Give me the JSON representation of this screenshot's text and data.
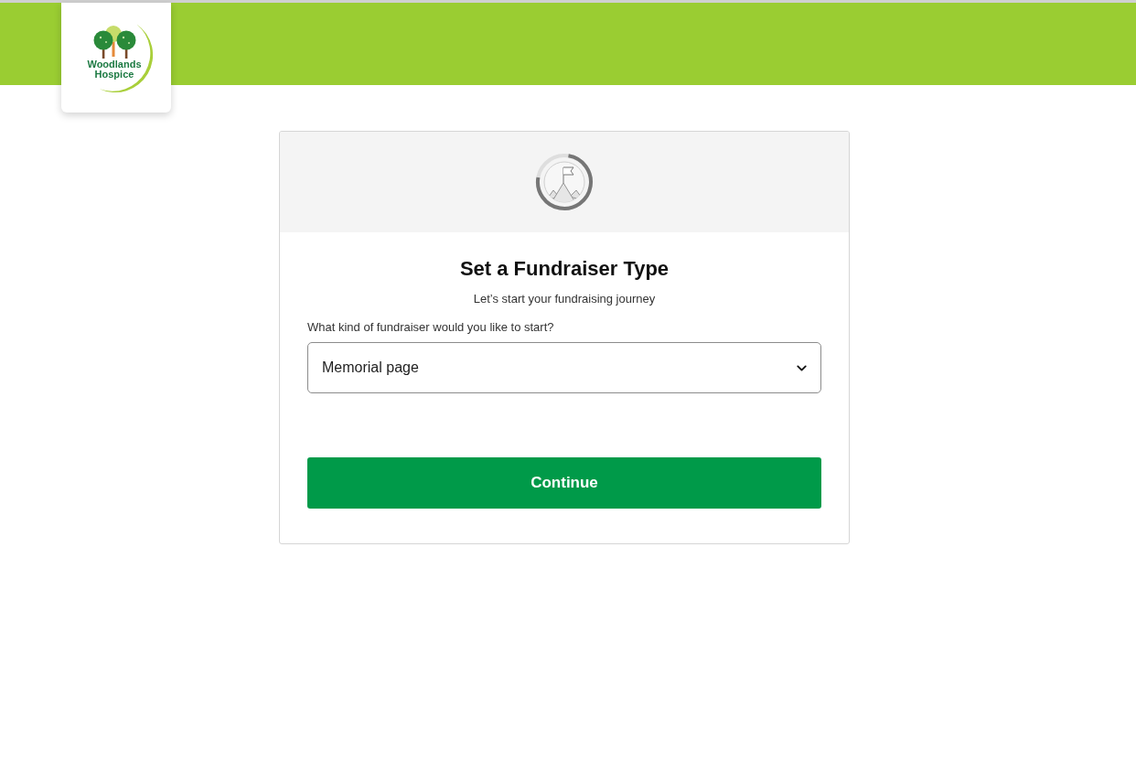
{
  "header": {
    "logo": {
      "lines": [
        "Woodlands",
        "Hospice"
      ]
    }
  },
  "card": {
    "title": "Set a Fundraiser Type",
    "subtitle": "Let’s start your fundraising journey",
    "field": {
      "label": "What kind of fundraiser would you like to start?",
      "value": "Memorial page"
    },
    "button": "Continue"
  }
}
